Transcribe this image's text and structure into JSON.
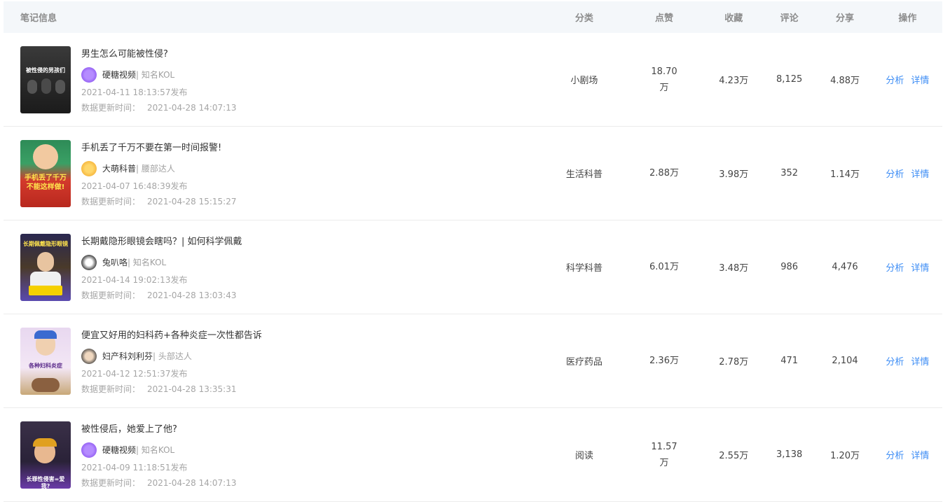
{
  "columns": {
    "info": "笔记信息",
    "category": "分类",
    "likes": "点赞",
    "favorites": "收藏",
    "comments": "评论",
    "shares": "分享",
    "actions": "操作"
  },
  "labels": {
    "updated": "数据更新时间：",
    "analyze": "分析",
    "detail": "详情"
  },
  "rows": [
    {
      "title": "男生怎么可能被性侵?",
      "author": "硬糖视频",
      "tag": "| 知名KOL",
      "published": "2021-04-11 18:13:57发布",
      "updated": "2021-04-28 14:07:13",
      "category": "小剧场",
      "likes": "18.70万",
      "favorites": "4.23万",
      "comments": "8,125",
      "shares": "4.88万",
      "thumb_caption": "被性侵的男孩们"
    },
    {
      "title": "手机丢了千万不要在第一时间报警!",
      "author": "大萌科普",
      "tag": "| 腰部达人",
      "published": "2021-04-07 16:48:39发布",
      "updated": "2021-04-28 15:15:27",
      "category": "生活科普",
      "likes": "2.88万",
      "favorites": "3.98万",
      "comments": "352",
      "shares": "1.14万",
      "thumb_caption": "手机丢了千万不能这样做!"
    },
    {
      "title": "长期戴隐形眼镜会瞎吗？| 如何科学佩戴",
      "author": "兔叭咯",
      "tag": "| 知名KOL",
      "published": "2021-04-14 19:02:13发布",
      "updated": "2021-04-28 13:03:43",
      "category": "科学科普",
      "likes": "6.01万",
      "favorites": "3.48万",
      "comments": "986",
      "shares": "4,476",
      "thumb_caption": "长期佩戴隐形眼镜"
    },
    {
      "title": "便宜又好用的妇科药+各种炎症一次性都告诉",
      "author": "妇产科刘利芬",
      "tag": "| 头部达人",
      "published": "2021-04-12 12:51:37发布",
      "updated": "2021-04-28 13:35:31",
      "category": "医疗药品",
      "likes": "2.36万",
      "favorites": "2.78万",
      "comments": "471",
      "shares": "2,104",
      "thumb_caption": "各种妇科炎症"
    },
    {
      "title": "被性侵后，她爱上了他?",
      "author": "硬糖视频",
      "tag": "| 知名KOL",
      "published": "2021-04-09 11:18:51发布",
      "updated": "2021-04-28 14:07:13",
      "category": "阅读",
      "likes": "11.57万",
      "favorites": "2.55万",
      "comments": "3,138",
      "shares": "1.20万",
      "thumb_caption": "长罪性侵害=爱我?"
    }
  ],
  "colors": {
    "link": "#3d8df5",
    "header_bg": "#f4f7fa",
    "muted": "#a6a6a6"
  }
}
